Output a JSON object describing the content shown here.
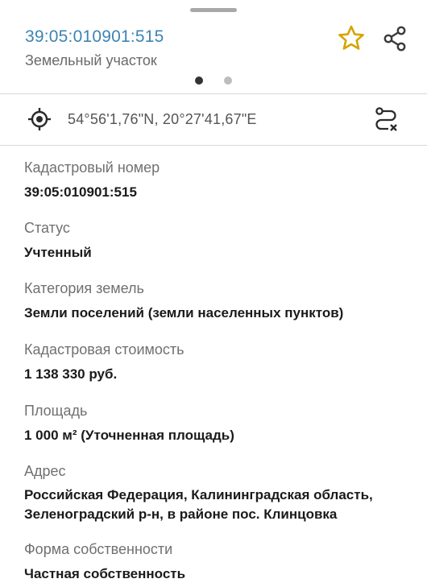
{
  "header": {
    "parcel_id": "39:05:010901:515",
    "parcel_type": "Земельный участок",
    "pager": {
      "count": 2,
      "active": 0
    }
  },
  "location": {
    "coordinates": "54°56'1,76\"N, 20°27'41,67\"E"
  },
  "icons": {
    "favorite": "star-outline-icon",
    "share": "share-icon",
    "locate": "crosshair-icon",
    "route": "route-clear-icon"
  },
  "colors": {
    "accent": "#3d84b2",
    "star": "#d6a400"
  },
  "fields": {
    "cadastral": {
      "label": "Кадастровый номер",
      "value": "39:05:010901:515"
    },
    "status": {
      "label": "Статус",
      "value": "Учтенный"
    },
    "category": {
      "label": "Категория земель",
      "value": "Земли поселений (земли населенных пунктов)"
    },
    "cost": {
      "label": "Кадастровая стоимость",
      "value": "1 138 330 руб."
    },
    "area": {
      "label": "Площадь",
      "value": "1 000 м² (Уточненная площадь)"
    },
    "address": {
      "label": "Адрес",
      "line1": "Российская Федерация, Калининградская область,",
      "line2": "Зеленоградский р-н, в районе пос. Клинцовка"
    },
    "ownership": {
      "label": "Форма собственности",
      "value": "Частная собственность"
    }
  }
}
